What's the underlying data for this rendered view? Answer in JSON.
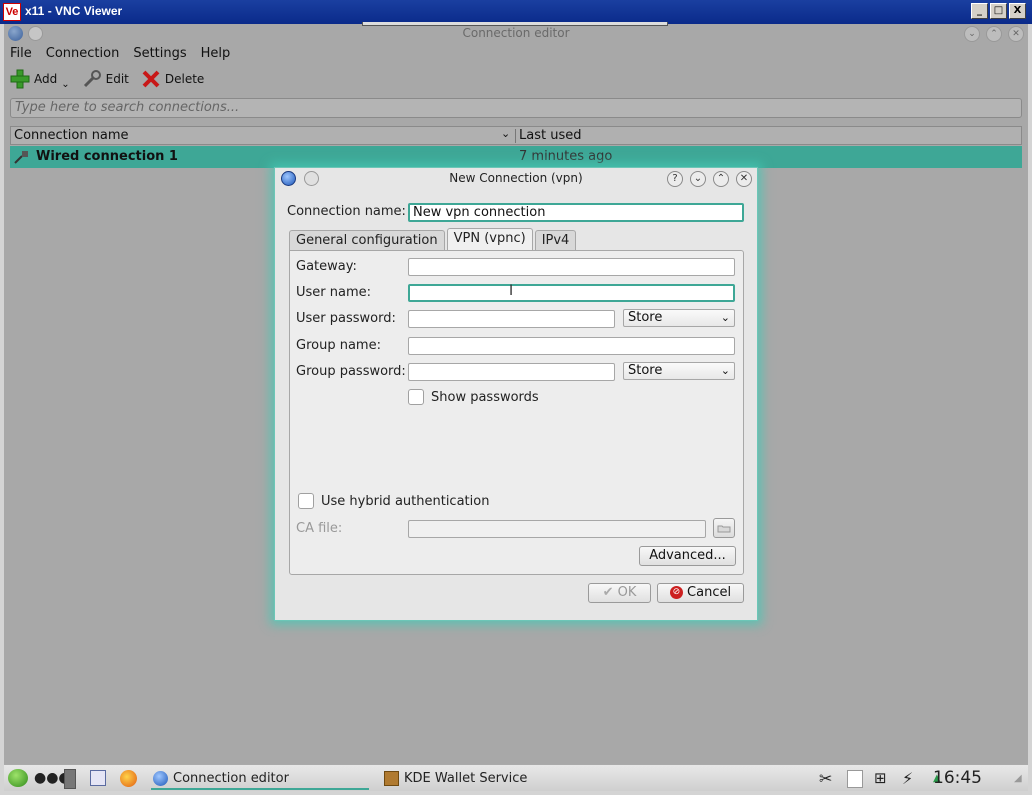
{
  "vnc": {
    "title": "x11 - VNC Viewer",
    "logo": "Ve",
    "buttons": [
      "_",
      "□",
      "X"
    ]
  },
  "app": {
    "title": "Connection editor",
    "menu": [
      "File",
      "Connection",
      "Settings",
      "Help"
    ],
    "toolbar": {
      "add_label": "Add",
      "edit_label": "Edit",
      "delete_label": "Delete"
    },
    "search_placeholder": "Type here to search connections...",
    "columns": [
      "Connection name",
      "Last used"
    ],
    "rows": [
      {
        "name": "Wired connection 1",
        "last_used": "7 minutes ago"
      }
    ]
  },
  "dialog": {
    "title": "New Connection (vpn)",
    "controls": [
      "?",
      "⌄",
      "⌃",
      "✕"
    ],
    "connection_name_label": "Connection name:",
    "connection_name_value": "New vpn connection",
    "tabs": [
      "General configuration",
      "VPN (vpnc)",
      "IPv4"
    ],
    "active_tab": "VPN (vpnc)",
    "fields": {
      "gateway_label": "Gateway:",
      "gateway_value": "",
      "user_name_label": "User name:",
      "user_name_value": "",
      "user_password_label": "User password:",
      "user_password_value": "",
      "user_password_storage": "Store",
      "group_name_label": "Group name:",
      "group_name_value": "",
      "group_password_label": "Group password:",
      "group_password_value": "",
      "group_password_storage": "Store"
    },
    "show_passwords_label": "Show passwords",
    "hybrid_auth_label": "Use hybrid authentication",
    "ca_file_label": "CA file:",
    "ca_file_value": "",
    "advanced_label": "Advanced...",
    "ok_label": "OK",
    "cancel_label": "Cancel"
  },
  "taskbar": {
    "tasks": [
      "Connection editor",
      "KDE Wallet Service"
    ],
    "clock": "16:45"
  },
  "colors": {
    "accent": "#3ea796",
    "vnc_titlebar": "#1a3fa0"
  }
}
